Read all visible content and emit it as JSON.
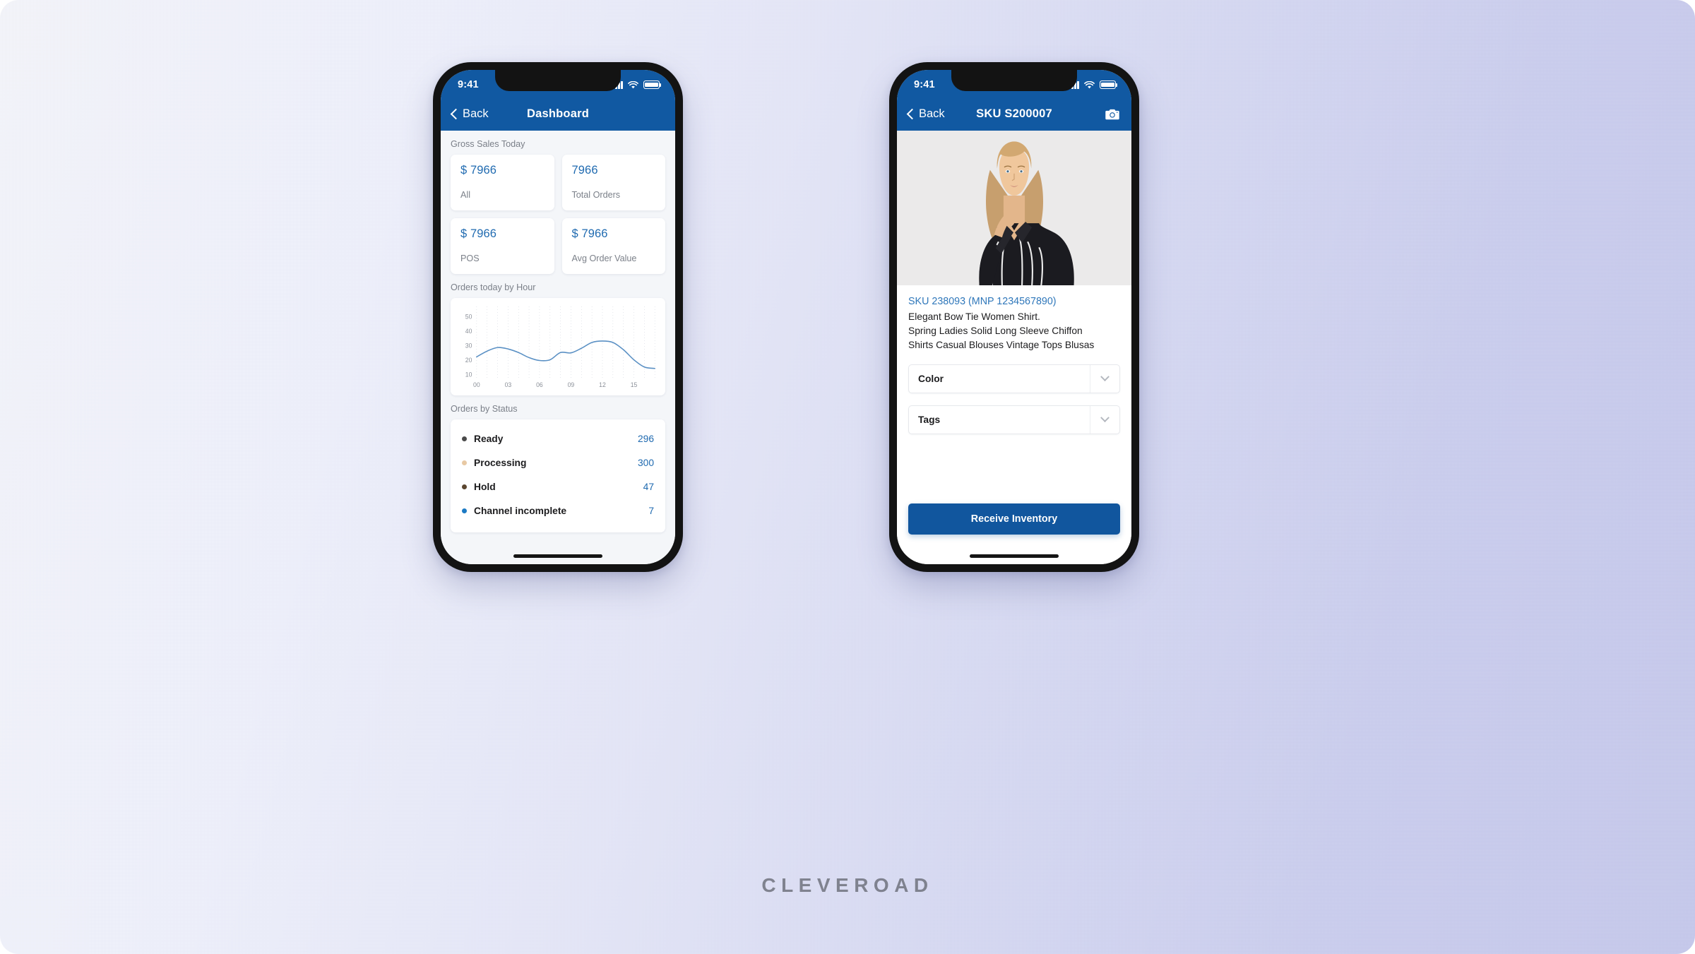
{
  "brand": "CLEVEROAD",
  "phone_left": {
    "statusbar": {
      "time": "9:41",
      "signal_icon": "signal-bars-icon",
      "wifi_icon": "wifi-icon",
      "battery_icon": "battery-icon"
    },
    "navbar": {
      "back_label": "Back",
      "title": "Dashboard"
    },
    "gross_sales": {
      "section_label": "Gross Sales Today",
      "cards": [
        {
          "value": "$ 7966",
          "label": "All"
        },
        {
          "value": "7966",
          "label": "Total Orders"
        },
        {
          "value": "$ 7966",
          "label": "POS"
        },
        {
          "value": "$ 7966",
          "label": "Avg Order Value"
        }
      ]
    },
    "orders_chart": {
      "section_label": "Orders today by Hour"
    },
    "orders_status": {
      "section_label": "Orders by Status",
      "rows": [
        {
          "label": "Ready",
          "count": "296",
          "color": "#4a4a4a"
        },
        {
          "label": "Processing",
          "count": "300",
          "color": "#e8c9a4"
        },
        {
          "label": "Hold",
          "count": "47",
          "color": "#5b462f"
        },
        {
          "label": "Channel incomplete",
          "count": "7",
          "color": "#1c7ac4"
        }
      ]
    }
  },
  "phone_right": {
    "statusbar": {
      "time": "9:41",
      "signal_icon": "signal-bars-icon",
      "wifi_icon": "wifi-icon",
      "battery_icon": "battery-icon"
    },
    "navbar": {
      "back_label": "Back",
      "title": "SKU S200007",
      "camera_icon": "camera-icon"
    },
    "product": {
      "photo_alt": "woman-in-striped-shirt-photo",
      "sku_line": "SKU 238093 (MNP 1234567890)",
      "description": "Elegant Bow Tie Women Shirt.\nSpring Ladies Solid Long Sleeve Chiffon\nShirts Casual Blouses Vintage Tops Blusas",
      "fields": [
        {
          "label": "Color",
          "caret_icon": "chevron-down-icon"
        },
        {
          "label": "Tags",
          "caret_icon": "chevron-down-icon"
        }
      ],
      "primary_button": "Receive Inventory"
    }
  },
  "colors": {
    "header_blue": "#1159a2",
    "accent_blue": "#1f6ab0",
    "button_blue": "#11569e",
    "chart_line": "#5a90c4"
  },
  "chart_data": {
    "type": "line",
    "title": "Orders today by Hour",
    "xlabel": "",
    "ylabel": "",
    "x": [
      0,
      1,
      2,
      3,
      4,
      5,
      6,
      7,
      8,
      9,
      10,
      11,
      12,
      13,
      14,
      15,
      16,
      17
    ],
    "values": [
      22,
      26,
      28.5,
      27.5,
      25,
      21.5,
      19.5,
      20,
      25,
      24.8,
      28,
      32,
      33,
      32,
      27,
      20,
      15,
      14
    ],
    "xticks": [
      "00",
      "03",
      "06",
      "09",
      "12",
      "15"
    ],
    "xtick_positions": [
      0,
      3,
      6,
      9,
      12,
      15
    ],
    "yticks": [
      10,
      20,
      30,
      40,
      50
    ],
    "ylim": [
      8,
      55
    ],
    "xlim": [
      0,
      17.5
    ],
    "grid": "vertical-dotted",
    "legend": "none",
    "line_color": "#5a90c4"
  }
}
